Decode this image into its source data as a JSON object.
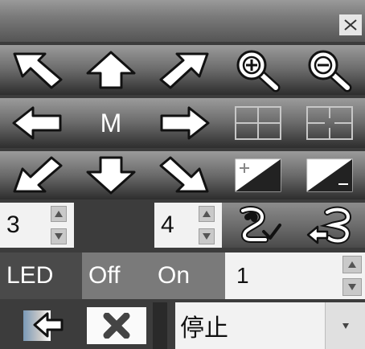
{
  "titlebar": {
    "close_icon": "close-icon"
  },
  "row_pan_zoom_1": [
    "arrow-up-left-icon",
    "arrow-up-icon",
    "arrow-up-right-icon",
    "zoom-in-icon",
    "zoom-out-icon"
  ],
  "row_pan_2": {
    "home_label": "M",
    "icons": [
      "arrow-left-icon",
      "arrow-right-icon",
      "focus-near-icon",
      "focus-far-icon"
    ]
  },
  "row_pan_3": [
    "arrow-down-left-icon",
    "arrow-down-icon",
    "arrow-down-right-icon",
    "brightness-plus-icon",
    "brightness-minus-icon"
  ],
  "presets": {
    "speed_value": "3",
    "preset_value": "4",
    "set_preset_icon": "set-preset-icon",
    "call_preset_icon": "call-preset-icon"
  },
  "led": {
    "label": "LED",
    "off_label": "Off",
    "on_label": "On",
    "value": "1"
  },
  "bottom": {
    "image_return_icon": "image-return-icon",
    "cancel_icon": "close-x-icon",
    "select_value": "停止"
  }
}
